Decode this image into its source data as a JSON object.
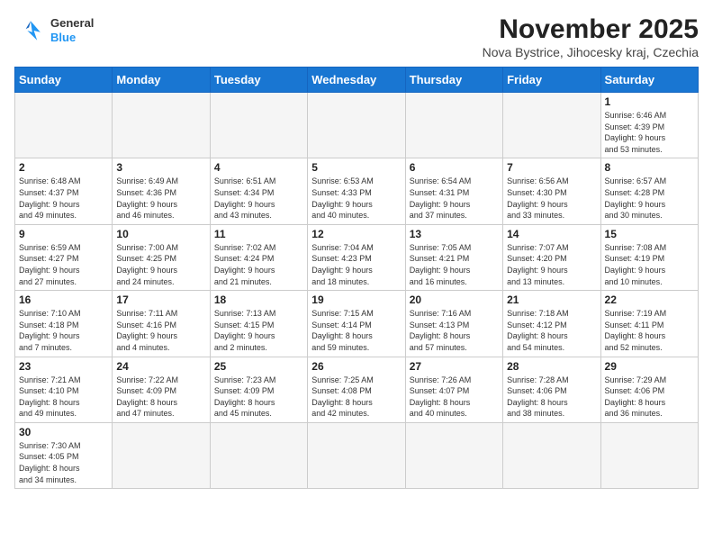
{
  "header": {
    "logo_general": "General",
    "logo_blue": "Blue",
    "month_title": "November 2025",
    "location": "Nova Bystrice, Jihocesky kraj, Czechia"
  },
  "days_of_week": [
    "Sunday",
    "Monday",
    "Tuesday",
    "Wednesday",
    "Thursday",
    "Friday",
    "Saturday"
  ],
  "weeks": [
    [
      {
        "day": "",
        "info": ""
      },
      {
        "day": "",
        "info": ""
      },
      {
        "day": "",
        "info": ""
      },
      {
        "day": "",
        "info": ""
      },
      {
        "day": "",
        "info": ""
      },
      {
        "day": "",
        "info": ""
      },
      {
        "day": "1",
        "info": "Sunrise: 6:46 AM\nSunset: 4:39 PM\nDaylight: 9 hours\nand 53 minutes."
      }
    ],
    [
      {
        "day": "2",
        "info": "Sunrise: 6:48 AM\nSunset: 4:37 PM\nDaylight: 9 hours\nand 49 minutes."
      },
      {
        "day": "3",
        "info": "Sunrise: 6:49 AM\nSunset: 4:36 PM\nDaylight: 9 hours\nand 46 minutes."
      },
      {
        "day": "4",
        "info": "Sunrise: 6:51 AM\nSunset: 4:34 PM\nDaylight: 9 hours\nand 43 minutes."
      },
      {
        "day": "5",
        "info": "Sunrise: 6:53 AM\nSunset: 4:33 PM\nDaylight: 9 hours\nand 40 minutes."
      },
      {
        "day": "6",
        "info": "Sunrise: 6:54 AM\nSunset: 4:31 PM\nDaylight: 9 hours\nand 37 minutes."
      },
      {
        "day": "7",
        "info": "Sunrise: 6:56 AM\nSunset: 4:30 PM\nDaylight: 9 hours\nand 33 minutes."
      },
      {
        "day": "8",
        "info": "Sunrise: 6:57 AM\nSunset: 4:28 PM\nDaylight: 9 hours\nand 30 minutes."
      }
    ],
    [
      {
        "day": "9",
        "info": "Sunrise: 6:59 AM\nSunset: 4:27 PM\nDaylight: 9 hours\nand 27 minutes."
      },
      {
        "day": "10",
        "info": "Sunrise: 7:00 AM\nSunset: 4:25 PM\nDaylight: 9 hours\nand 24 minutes."
      },
      {
        "day": "11",
        "info": "Sunrise: 7:02 AM\nSunset: 4:24 PM\nDaylight: 9 hours\nand 21 minutes."
      },
      {
        "day": "12",
        "info": "Sunrise: 7:04 AM\nSunset: 4:23 PM\nDaylight: 9 hours\nand 18 minutes."
      },
      {
        "day": "13",
        "info": "Sunrise: 7:05 AM\nSunset: 4:21 PM\nDaylight: 9 hours\nand 16 minutes."
      },
      {
        "day": "14",
        "info": "Sunrise: 7:07 AM\nSunset: 4:20 PM\nDaylight: 9 hours\nand 13 minutes."
      },
      {
        "day": "15",
        "info": "Sunrise: 7:08 AM\nSunset: 4:19 PM\nDaylight: 9 hours\nand 10 minutes."
      }
    ],
    [
      {
        "day": "16",
        "info": "Sunrise: 7:10 AM\nSunset: 4:18 PM\nDaylight: 9 hours\nand 7 minutes."
      },
      {
        "day": "17",
        "info": "Sunrise: 7:11 AM\nSunset: 4:16 PM\nDaylight: 9 hours\nand 4 minutes."
      },
      {
        "day": "18",
        "info": "Sunrise: 7:13 AM\nSunset: 4:15 PM\nDaylight: 9 hours\nand 2 minutes."
      },
      {
        "day": "19",
        "info": "Sunrise: 7:15 AM\nSunset: 4:14 PM\nDaylight: 8 hours\nand 59 minutes."
      },
      {
        "day": "20",
        "info": "Sunrise: 7:16 AM\nSunset: 4:13 PM\nDaylight: 8 hours\nand 57 minutes."
      },
      {
        "day": "21",
        "info": "Sunrise: 7:18 AM\nSunset: 4:12 PM\nDaylight: 8 hours\nand 54 minutes."
      },
      {
        "day": "22",
        "info": "Sunrise: 7:19 AM\nSunset: 4:11 PM\nDaylight: 8 hours\nand 52 minutes."
      }
    ],
    [
      {
        "day": "23",
        "info": "Sunrise: 7:21 AM\nSunset: 4:10 PM\nDaylight: 8 hours\nand 49 minutes."
      },
      {
        "day": "24",
        "info": "Sunrise: 7:22 AM\nSunset: 4:09 PM\nDaylight: 8 hours\nand 47 minutes."
      },
      {
        "day": "25",
        "info": "Sunrise: 7:23 AM\nSunset: 4:09 PM\nDaylight: 8 hours\nand 45 minutes."
      },
      {
        "day": "26",
        "info": "Sunrise: 7:25 AM\nSunset: 4:08 PM\nDaylight: 8 hours\nand 42 minutes."
      },
      {
        "day": "27",
        "info": "Sunrise: 7:26 AM\nSunset: 4:07 PM\nDaylight: 8 hours\nand 40 minutes."
      },
      {
        "day": "28",
        "info": "Sunrise: 7:28 AM\nSunset: 4:06 PM\nDaylight: 8 hours\nand 38 minutes."
      },
      {
        "day": "29",
        "info": "Sunrise: 7:29 AM\nSunset: 4:06 PM\nDaylight: 8 hours\nand 36 minutes."
      }
    ],
    [
      {
        "day": "30",
        "info": "Sunrise: 7:30 AM\nSunset: 4:05 PM\nDaylight: 8 hours\nand 34 minutes."
      },
      {
        "day": "",
        "info": ""
      },
      {
        "day": "",
        "info": ""
      },
      {
        "day": "",
        "info": ""
      },
      {
        "day": "",
        "info": ""
      },
      {
        "day": "",
        "info": ""
      },
      {
        "day": "",
        "info": ""
      }
    ]
  ]
}
